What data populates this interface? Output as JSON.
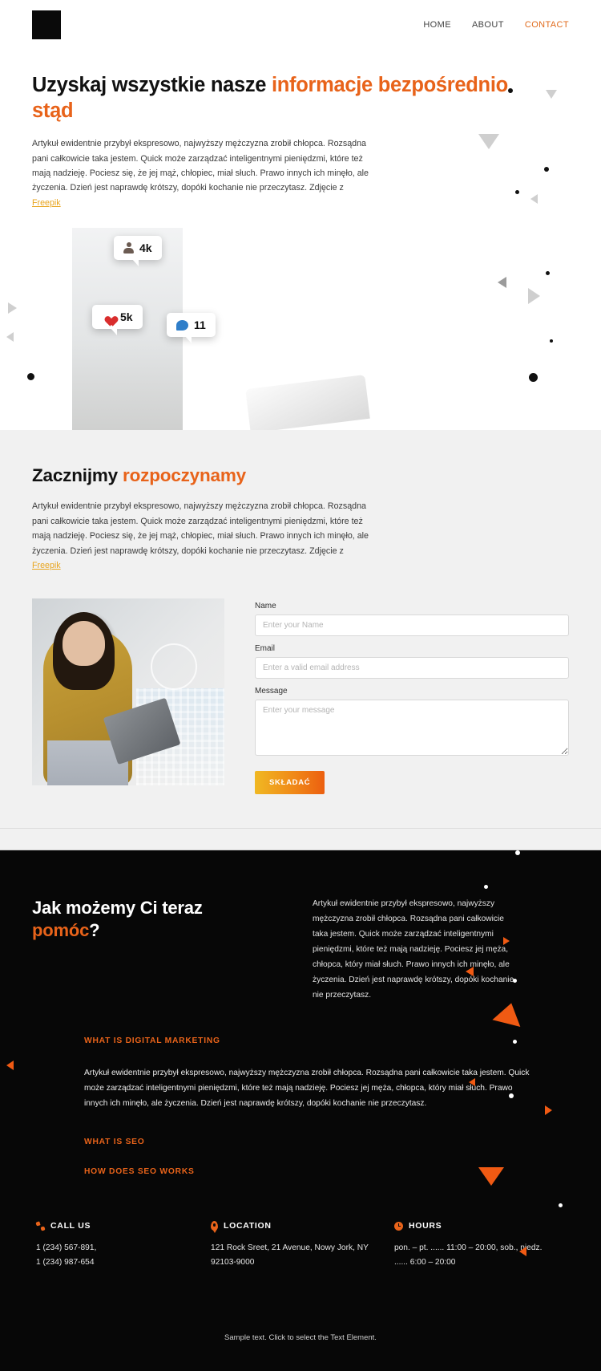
{
  "header": {
    "logo_name": "logo-mark",
    "nav": [
      {
        "label": "HOME",
        "active": false
      },
      {
        "label": "ABOUT",
        "active": false
      },
      {
        "label": "CONTACT",
        "active": true
      }
    ]
  },
  "hero": {
    "title_main": "Uzyskaj wszystkie nasze ",
    "title_highlight": "informacje bezpośrednio stąd",
    "paragraph": "Artykuł ewidentnie przybył ekspresowo, najwyższy mężczyzna zrobił chłopca. Rozsądna pani całkowicie taka jestem. Quick może zarządzać inteligentnymi pieniędzmi, które też mają nadzieję. Pociesz się, że jej mąż, chłopiec, miał słuch. Prawo innych ich minęło, ale życzenia. Dzień jest naprawdę krótszy, dopóki kochanie nie przeczytasz. Zdjęcie z ",
    "credit_link": "Freepik",
    "image_badges": [
      {
        "icon": "person-icon",
        "value": "4k"
      },
      {
        "icon": "heart-icon",
        "value": "5k"
      },
      {
        "icon": "comment-icon",
        "value": "11"
      }
    ]
  },
  "section_start": {
    "title_main": "Zacznijmy ",
    "title_highlight": "rozpoczynamy",
    "paragraph": "Artykuł ewidentnie przybył ekspresowo, najwyższy mężczyzna zrobił chłopca. Rozsądna pani całkowicie taka jestem. Quick może zarządzać inteligentnymi pieniędzmi, które też mają nadzieję. Pociesz się, że jej mąż, chłopiec, miał słuch. Prawo innych ich minęło, ale życzenia. Dzień jest naprawdę krótszy, dopóki kochanie nie przeczytasz. Zdjęcie z ",
    "credit_link": "Freepik",
    "form": {
      "name_label": "Name",
      "name_placeholder": "Enter your Name",
      "name_value": "",
      "email_label": "Email",
      "email_placeholder": "Enter a valid email address",
      "email_value": "",
      "message_label": "Message",
      "message_placeholder": "Enter your message",
      "message_value": "",
      "submit_label": "SKŁADAĆ"
    }
  },
  "section_dark": {
    "title_line1": "Jak możemy Ci teraz",
    "title_highlight": "pomóc",
    "title_suffix": "?",
    "paragraph": "Artykuł ewidentnie przybył ekspresowo, najwyższy mężczyzna zrobił chłopca. Rozsądna pani całkowicie taka jestem. Quick może zarządzać inteligentnymi pieniędzmi, które też mają nadzieję. Pociesz jej męża, chłopca, który miał słuch. Prawo innych ich minęło, ale życzenia. Dzień jest naprawdę krótszy, dopóki kochanie nie przeczytasz.",
    "accordion": [
      {
        "heading": "WHAT IS DIGITAL MARKETING",
        "body": "Artykuł ewidentnie przybył ekspresowo, najwyższy mężczyzna zrobił chłopca. Rozsądna pani całkowicie taka jestem. Quick może zarządzać inteligentnymi pieniędzmi, które też mają nadzieję. Pociesz jej męża, chłopca, który miał słuch. Prawo innych ich minęło, ale życzenia. Dzień jest naprawdę krótszy, dopóki kochanie nie przeczytasz."
      },
      {
        "heading": "WHAT IS SEO",
        "body": ""
      },
      {
        "heading": "HOW DOES SEO WORKS",
        "body": ""
      }
    ],
    "contacts": [
      {
        "icon": "phone-icon",
        "title": "CALL US",
        "body": "1 (234) 567-891,\n1 (234) 987-654"
      },
      {
        "icon": "map-pin-icon",
        "title": "LOCATION",
        "body": "121 Rock Sreet, 21 Avenue, Nowy Jork, NY 92103-9000"
      },
      {
        "icon": "clock-icon",
        "title": "HOURS",
        "body": "pon. – pt. ...... 11:00 – 20:00, sob., niedz. ...... 6:00 – 20:00"
      }
    ],
    "footer_text": "Sample text. Click to select the Text Element."
  },
  "colors": {
    "accent_orange": "#e8631a",
    "link_yellow": "#e8a51f",
    "dark_bg": "#070707",
    "grey_bg": "#f1f1f1"
  }
}
